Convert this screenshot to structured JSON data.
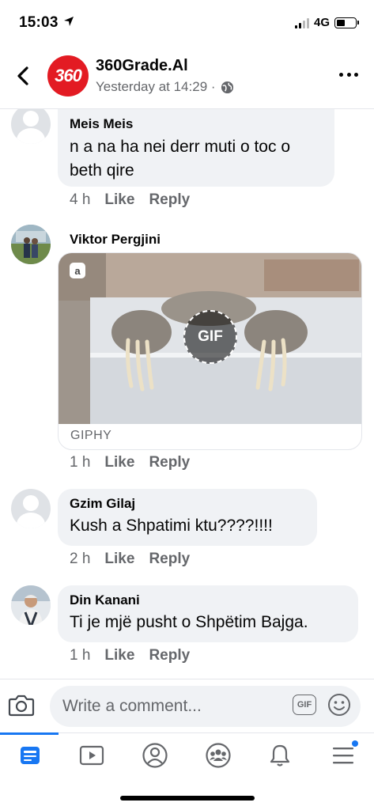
{
  "status_bar": {
    "time": "15:03",
    "network": "4G"
  },
  "header": {
    "page_name": "360Grade.Al",
    "avatar_text": "360",
    "post_time": "Yesterday at 14:29 ·"
  },
  "comments": [
    {
      "author": "Meis Meis",
      "text_lines": [
        "n a na ha nei derr muti o toc o",
        "beth qire"
      ],
      "time": "4 h",
      "like": "Like",
      "reply": "Reply"
    },
    {
      "author": "Viktor Pergjini",
      "gif_label": "GIF",
      "gif_source": "GIPHY",
      "time": "1 h",
      "like": "Like",
      "reply": "Reply"
    },
    {
      "author": "Gzim Gilaj",
      "text": "Kush a Shpatimi ktu????!!!!",
      "time": "2 h",
      "like": "Like",
      "reply": "Reply"
    },
    {
      "author": "Din Kanani",
      "text": "Ti je mjë pusht o Shpëtim Bajga.",
      "time": "1 h",
      "like": "Like",
      "reply": "Reply"
    }
  ],
  "composer": {
    "placeholder": "Write a comment...",
    "gif_button": "GIF"
  },
  "bottom_nav": {
    "items": [
      "news-feed",
      "watch",
      "profile",
      "groups",
      "notifications",
      "menu"
    ],
    "active": "news-feed"
  },
  "colors": {
    "accent": "#1877f2",
    "bubble": "#f0f2f5",
    "secondary_text": "#65676b",
    "brand_red": "#e31b23"
  },
  "signal_bars_active": 2,
  "signal_bars_total": 4,
  "battery_level": 0.45
}
